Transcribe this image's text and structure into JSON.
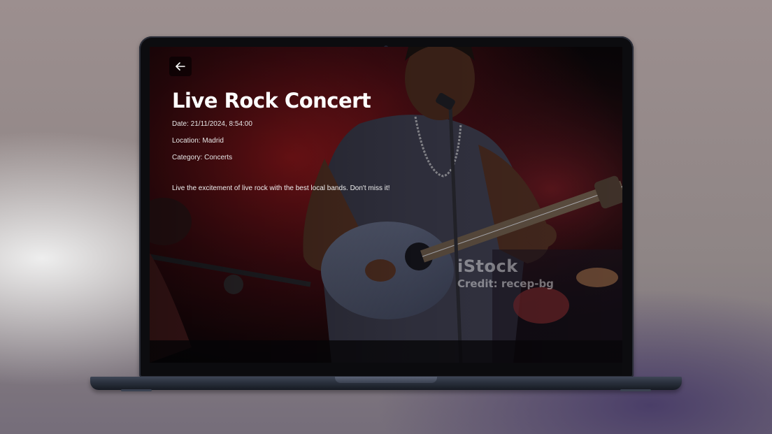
{
  "event": {
    "title": "Live Rock Concert",
    "date": "Date: 21/11/2024, 8:54:00",
    "location": "Location: Madrid",
    "category": "Category: Concerts",
    "description": "Live the excitement of live rock with the best local bands. Don't miss it!"
  },
  "back_icon": "arrow-left-icon",
  "watermark": {
    "brand": "iStock",
    "credit": "Credit: recep-bg"
  },
  "colors": {
    "background_top": "#9c8f8f",
    "laptop_body": "#0c0c0f",
    "stage_red": "#8a1418",
    "text": "#ffffff"
  }
}
